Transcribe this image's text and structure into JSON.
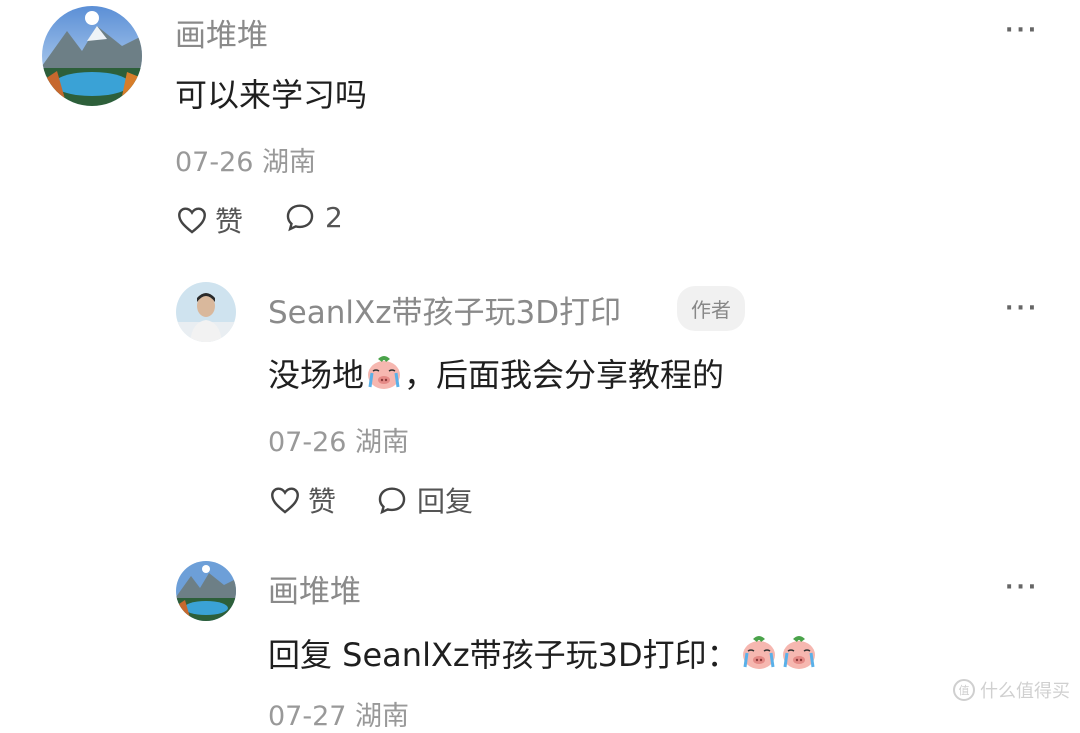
{
  "comments": [
    {
      "author": "画堆堆",
      "text": "可以来学习吗",
      "meta": "07-26 湖南",
      "like_label": "赞",
      "comment_count": "2",
      "more_label": "···"
    },
    {
      "author": "SeanlXz带孩子玩3D打印",
      "author_badge": "作者",
      "text_before_emoji": "没场地",
      "text_after_emoji": "，后面我会分享教程的",
      "meta": "07-26 湖南",
      "like_label": "赞",
      "reply_label": "回复",
      "more_label": "···"
    },
    {
      "author": "画堆堆",
      "text": "回复 SeanlXz带孩子玩3D打印：",
      "meta": "07-27 湖南",
      "more_label": "···"
    }
  ],
  "watermark": "什么值得买",
  "colors": {
    "name": "#8a8a8a",
    "text": "#1f1f1f",
    "meta": "#999999",
    "badge_bg": "#f1f1f1"
  }
}
